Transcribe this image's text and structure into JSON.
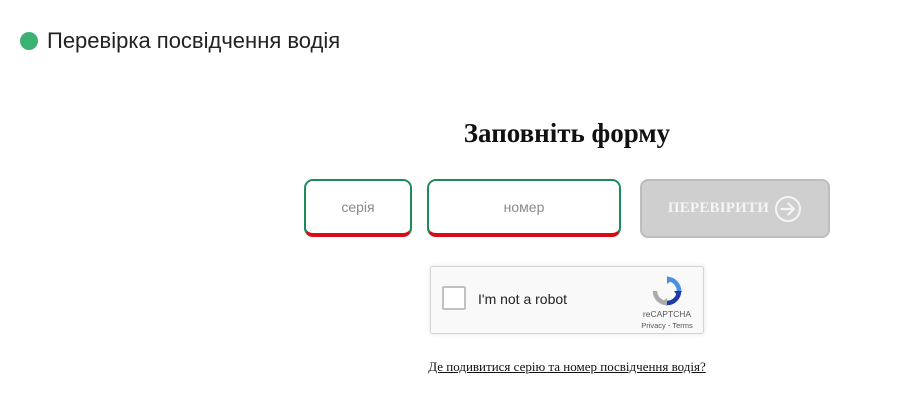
{
  "header": {
    "title": "Перевірка посвідчення водія",
    "status_color": "#3bb273"
  },
  "form": {
    "heading": "Заповніть форму",
    "series_placeholder": "серія",
    "series_value": "",
    "number_placeholder": "номер",
    "number_value": "",
    "submit_label": "ПЕРЕВІРИТИ",
    "submit_icon": "arrow-right-circle-icon",
    "field_border_color": "#1d8a5a",
    "field_error_color": "#d70c17",
    "submit_disabled_color": "#cfcfcf"
  },
  "recaptcha": {
    "label": "I'm not a robot",
    "brand": "reCAPTCHA",
    "privacy": "Privacy",
    "separator": " - ",
    "terms": "Terms",
    "checked": false
  },
  "help_link": {
    "text": "Де подивитися серію та номер посвідчення водія?"
  }
}
